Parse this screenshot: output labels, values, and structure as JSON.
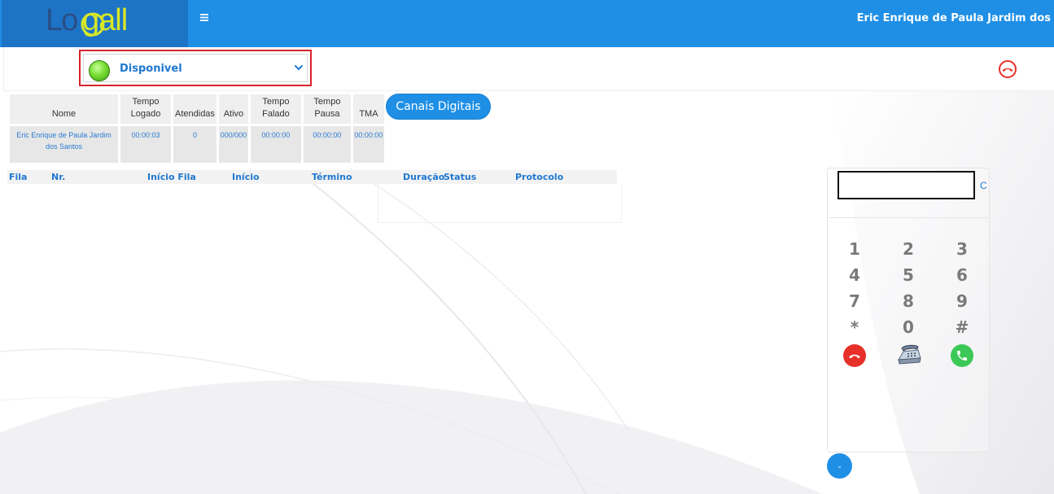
{
  "header": {
    "logo_text": "Logall",
    "menu_icon": "hamburger-icon",
    "user_name": "Eric Enrique de Paula Jardim dos"
  },
  "status": {
    "label": "Disponivel",
    "indicator_color": "#77dd33",
    "chevron_icon": "chevron-down-icon",
    "hangup_icon": "phone-hangup-icon"
  },
  "agent_table": {
    "headers": [
      [
        "Nome"
      ],
      [
        "Tempo",
        "Logado"
      ],
      [
        "Atendidas"
      ],
      [
        "Ativo"
      ],
      [
        "Tempo",
        "Falado"
      ],
      [
        "Tempo",
        "Pausa"
      ],
      [
        "TMA"
      ]
    ],
    "row": {
      "nome": "Eric Enrique de Paula Jardim dos Santos",
      "tempo_logado": "00:00:03",
      "atendidas": "0",
      "ativo": "000/000",
      "tempo_falado": "00:00:00",
      "tempo_pausa": "00:00:00",
      "tma": "00:00:00"
    }
  },
  "canais_button": "Canais Digitais",
  "calls_table": {
    "columns": [
      "Fila",
      "Nr.",
      "Início Fila",
      "Início",
      "Término",
      "Duração",
      "Status",
      "Protocolo"
    ]
  },
  "dialer": {
    "input_value": "",
    "clear_label": "C",
    "keys": [
      "1",
      "2",
      "3",
      "4",
      "5",
      "6",
      "7",
      "8",
      "9",
      "*",
      "0",
      "#"
    ],
    "hangup_icon": "phone-hangup-icon",
    "transfer_icon": "desk-phone-icon",
    "call_icon": "phone-call-icon",
    "minimize_label": "-"
  },
  "colors": {
    "topbar": "#1f8fe6",
    "logo_bg": "#1d74c7",
    "accent_text": "#1f78d1",
    "status_border": "#d9232a",
    "hangup_red": "#e8302a",
    "call_green": "#3cc856"
  }
}
